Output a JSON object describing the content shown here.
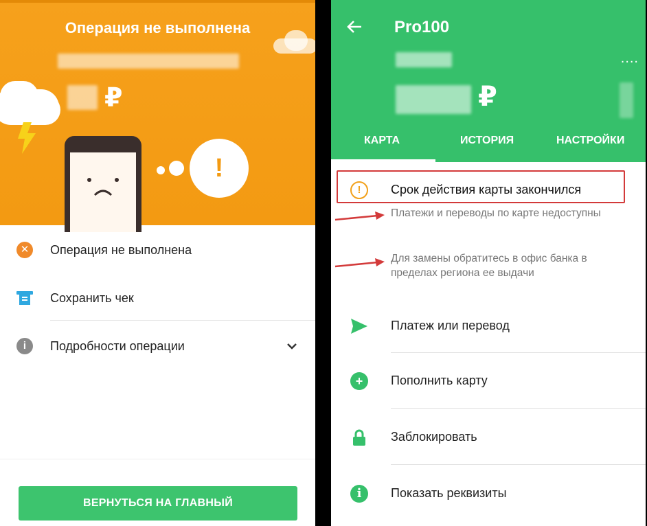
{
  "left": {
    "header": {
      "title": "Операция не выполнена",
      "currency": "₽"
    },
    "rows": [
      {
        "label": "Операция не выполнена",
        "icon": "x-circle-icon"
      },
      {
        "label": "Сохранить чек",
        "icon": "receipt-icon"
      },
      {
        "label": "Подробности операции",
        "icon": "info-icon"
      }
    ],
    "return_button": "ВЕРНУТЬСЯ НА ГЛАВНЫЙ"
  },
  "right": {
    "header": {
      "title": "Pro100",
      "currency": "₽",
      "more": "...."
    },
    "tabs": [
      "КАРТА",
      "ИСТОРИЯ",
      "НАСТРОЙКИ"
    ],
    "alert": {
      "title": "Срок действия карты закончился",
      "notes": [
        "Платежи и переводы по карте недоступны",
        "Для замены обратитесь в офис банка в пределах региона ее выдачи"
      ]
    },
    "actions": [
      {
        "label": "Платеж или перевод",
        "icon": "send-icon"
      },
      {
        "label": "Пополнить карту",
        "icon": "plus-circle-icon"
      },
      {
        "label": "Заблокировать",
        "icon": "lock-icon"
      },
      {
        "label": "Показать реквизиты",
        "icon": "info-icon"
      }
    ]
  },
  "colors": {
    "orange": "#f39a12",
    "green": "#36c06b",
    "red_outline": "#d33a3a",
    "warning": "#f2a019",
    "error_icon": "#f08a2a",
    "receipt_icon": "#2fa8e0"
  }
}
